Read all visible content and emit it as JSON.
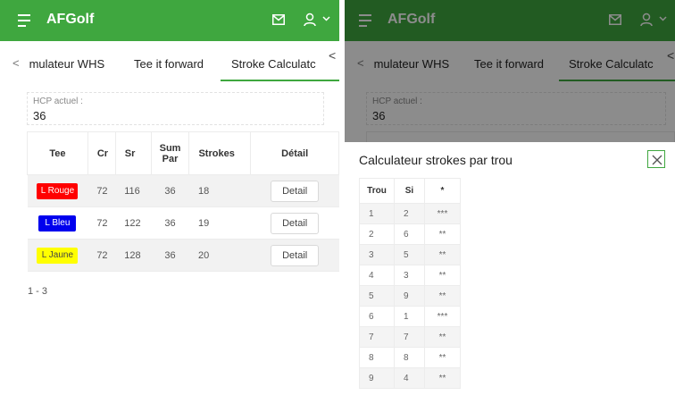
{
  "app": {
    "brand": "AFGolf"
  },
  "tabs": [
    {
      "label": " mulateur WHS"
    },
    {
      "label": "Tee it forward"
    },
    {
      "label": "Stroke Calculatc"
    }
  ],
  "tab_arrows": {
    "left": "<",
    "right": "<"
  },
  "hcp": {
    "label": "HCP actuel :",
    "value": "36"
  },
  "tees_table": {
    "headers": {
      "tee": "Tee",
      "cr": "Cr",
      "sr": "Sr",
      "sum_par": "Sum Par",
      "strokes": "Strokes",
      "detail": "Détail"
    },
    "rows": [
      {
        "tee": "L Rouge",
        "tee_color": "#ff0000",
        "tee_text_color": "#ffffff",
        "cr": "72",
        "sr": "116",
        "sum_par": "36",
        "strokes": "18",
        "detail": "Detail"
      },
      {
        "tee": "L Bleu",
        "tee_color": "#0000ee",
        "tee_text_color": "#ffffff",
        "cr": "72",
        "sr": "122",
        "sum_par": "36",
        "strokes": "19",
        "detail": "Detail"
      },
      {
        "tee": "L Jaune",
        "tee_color": "#ffff00",
        "tee_text_color": "#444444",
        "cr": "72",
        "sr": "128",
        "sum_par": "36",
        "strokes": "20",
        "detail": "Detail"
      }
    ],
    "pager": "1 - 3"
  },
  "modal": {
    "title": "Calculateur strokes par trou",
    "headers": {
      "trou": "Trou",
      "si": "Si",
      "strokes": "*"
    },
    "rows": [
      {
        "trou": "1",
        "si": "2",
        "strokes": "***"
      },
      {
        "trou": "2",
        "si": "6",
        "strokes": "**"
      },
      {
        "trou": "3",
        "si": "5",
        "strokes": "**"
      },
      {
        "trou": "4",
        "si": "3",
        "strokes": "**"
      },
      {
        "trou": "5",
        "si": "9",
        "strokes": "**"
      },
      {
        "trou": "6",
        "si": "1",
        "strokes": "***"
      },
      {
        "trou": "7",
        "si": "7",
        "strokes": "**"
      },
      {
        "trou": "8",
        "si": "8",
        "strokes": "**"
      },
      {
        "trou": "9",
        "si": "4",
        "strokes": "**"
      }
    ]
  },
  "colors": {
    "header_green": "#3fa73f",
    "accent": "#3fa73f"
  },
  "icons": {
    "menu": "menu-icon",
    "mail": "mail-icon",
    "user": "user-icon",
    "chevron": "chevron-down-icon",
    "close": "close-icon"
  }
}
